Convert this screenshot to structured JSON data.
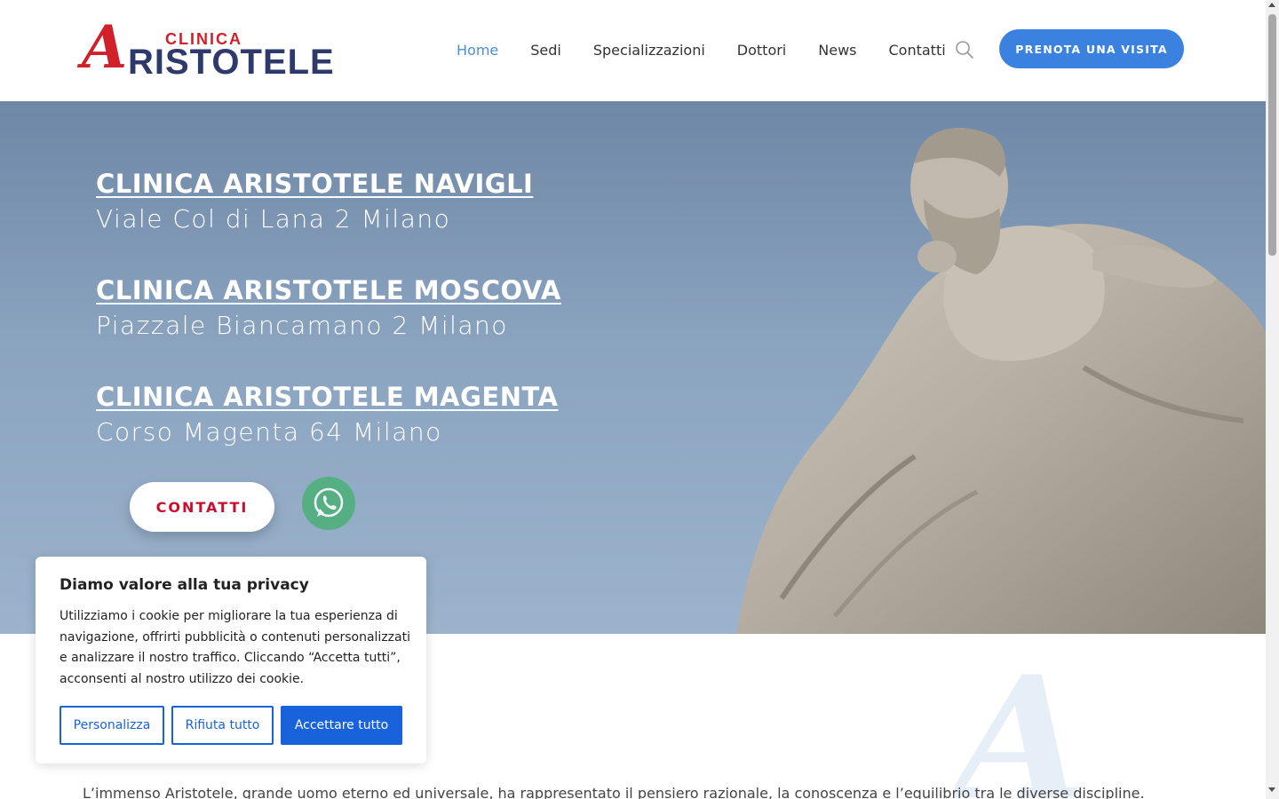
{
  "header": {
    "logo": {
      "big_letter": "A",
      "top_text": "CLINICA",
      "main_text": "RISTOTELE"
    },
    "nav": [
      {
        "label": "Home",
        "active": true
      },
      {
        "label": "Sedi",
        "active": false
      },
      {
        "label": "Specializzazioni",
        "active": false
      },
      {
        "label": "Dottori",
        "active": false
      },
      {
        "label": "News",
        "active": false
      },
      {
        "label": "Contatti",
        "active": false
      }
    ],
    "search_icon": "search-icon",
    "cta_label": "PRENOTA UNA VISITA"
  },
  "hero": {
    "locations": [
      {
        "name": "CLINICA ARISTOTELE NAVIGLI",
        "address": "Viale Col di Lana 2 Milano"
      },
      {
        "name": "CLINICA ARISTOTELE MOSCOVA",
        "address": "Piazzale Biancamano 2 Milano"
      },
      {
        "name": "CLINICA ARISTOTELE MAGENTA",
        "address": "Corso Magenta 64 Milano"
      }
    ],
    "contact_label": "CONTATTI",
    "whatsapp_icon": "whatsapp-icon",
    "image": "statue-image"
  },
  "intro": {
    "text": "L’immenso Aristotele, grande uomo eterno ed universale, ha rappresentato il pensiero razionale, la conoscenza e l’equilibrio tra le diverse discipline."
  },
  "cookie": {
    "title": "Diamo valore alla tua privacy",
    "text": "Utilizziamo i cookie per migliorare la tua esperienza di navigazione, offrirti pubblicità o contenuti personalizzati e analizzare il nostro traffico. Cliccando “Accetta tutti”, acconsenti al nostro utilizzo dei cookie.",
    "customize_label": "Personalizza",
    "reject_label": "Rifiuta tutto",
    "accept_label": "Accettare tutto"
  },
  "colors": {
    "accent": "#3b82e0",
    "brand_red": "#d0202a",
    "brand_navy": "#2e3a6b",
    "cookie_blue": "#1863dc"
  }
}
